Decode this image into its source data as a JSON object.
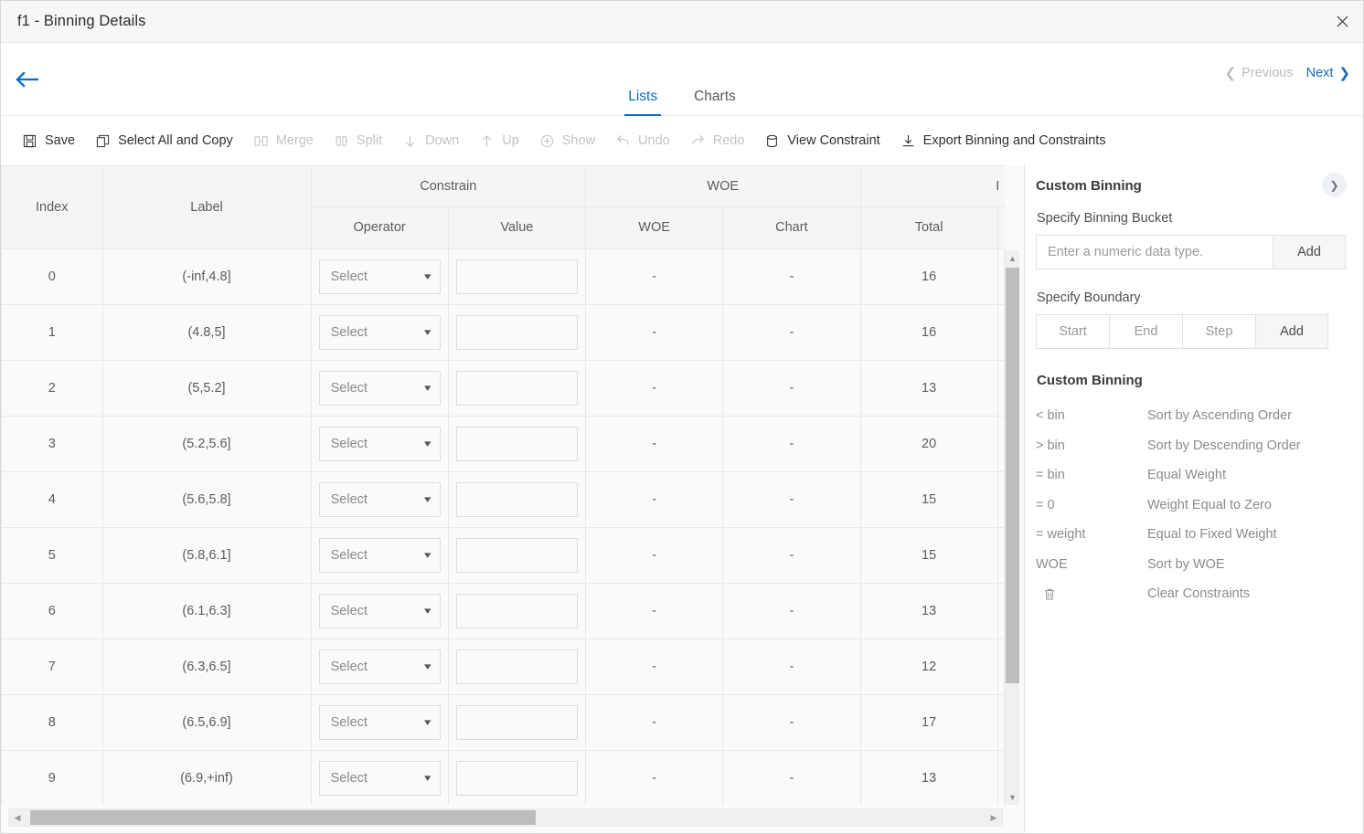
{
  "window": {
    "title": "f1 - Binning Details",
    "close_icon": "close-icon"
  },
  "nav": {
    "back_icon": "back-arrow-icon",
    "tabs": [
      {
        "label": "Lists",
        "active": true
      },
      {
        "label": "Charts",
        "active": false
      }
    ],
    "previous_label": "Previous",
    "next_label": "Next",
    "previous_enabled": false,
    "next_enabled": true,
    "accent_color": "#0f6cbd",
    "disabled_color": "#bdbdbd"
  },
  "toolbar": {
    "items": [
      {
        "label": "Save",
        "icon": "save-icon",
        "enabled": true
      },
      {
        "label": "Select All and Copy",
        "icon": "copy-icon",
        "enabled": true
      },
      {
        "label": "Merge",
        "icon": "merge-icon",
        "enabled": false
      },
      {
        "label": "Split",
        "icon": "split-icon",
        "enabled": false
      },
      {
        "label": "Down",
        "icon": "arrow-down-icon",
        "enabled": false
      },
      {
        "label": "Up",
        "icon": "arrow-up-icon",
        "enabled": false
      },
      {
        "label": "Show",
        "icon": "plus-circle-icon",
        "enabled": false
      },
      {
        "label": "Undo",
        "icon": "undo-icon",
        "enabled": false
      },
      {
        "label": "Redo",
        "icon": "redo-icon",
        "enabled": false
      },
      {
        "label": "View Constraint",
        "icon": "database-icon",
        "enabled": true
      },
      {
        "label": "Export Binning and Constraints",
        "icon": "export-icon",
        "enabled": true
      }
    ]
  },
  "grid": {
    "group_headers": {
      "index": "Index",
      "label": "Label",
      "constrain": "Constrain",
      "woe": "WOE",
      "partial": "I"
    },
    "sub_headers": {
      "operator": "Operator",
      "value": "Value",
      "woe": "WOE",
      "chart": "Chart",
      "total": "Total"
    },
    "operator_placeholder": "Select",
    "value_placeholder": "",
    "empty_mark": "-",
    "rows": [
      {
        "index": "0",
        "label": "(-inf,4.8]",
        "operator": "Select",
        "value": "",
        "woe": "-",
        "chart": "-",
        "total": "16"
      },
      {
        "index": "1",
        "label": "(4.8,5]",
        "operator": "Select",
        "value": "",
        "woe": "-",
        "chart": "-",
        "total": "16"
      },
      {
        "index": "2",
        "label": "(5,5.2]",
        "operator": "Select",
        "value": "",
        "woe": "-",
        "chart": "-",
        "total": "13"
      },
      {
        "index": "3",
        "label": "(5.2,5.6]",
        "operator": "Select",
        "value": "",
        "woe": "-",
        "chart": "-",
        "total": "20"
      },
      {
        "index": "4",
        "label": "(5.6,5.8]",
        "operator": "Select",
        "value": "",
        "woe": "-",
        "chart": "-",
        "total": "15"
      },
      {
        "index": "5",
        "label": "(5.8,6.1]",
        "operator": "Select",
        "value": "",
        "woe": "-",
        "chart": "-",
        "total": "15"
      },
      {
        "index": "6",
        "label": "(6.1,6.3]",
        "operator": "Select",
        "value": "",
        "woe": "-",
        "chart": "-",
        "total": "13"
      },
      {
        "index": "7",
        "label": "(6.3,6.5]",
        "operator": "Select",
        "value": "",
        "woe": "-",
        "chart": "-",
        "total": "12"
      },
      {
        "index": "8",
        "label": "(6.5,6.9]",
        "operator": "Select",
        "value": "",
        "woe": "-",
        "chart": "-",
        "total": "17"
      },
      {
        "index": "9",
        "label": "(6.9,+inf)",
        "operator": "Select",
        "value": "",
        "woe": "-",
        "chart": "-",
        "total": "13"
      }
    ]
  },
  "panel": {
    "heading": "Custom Binning",
    "collapse_icon": "chevron-right-icon",
    "bucket_label": "Specify Binning Bucket",
    "bucket_placeholder": "Enter a numeric data type.",
    "bucket_value": "",
    "bucket_add_label": "Add",
    "boundary_label": "Specify Boundary",
    "boundary_start_placeholder": "Start",
    "boundary_start_value": "",
    "boundary_end_placeholder": "End",
    "boundary_end_value": "",
    "boundary_step_placeholder": "Step",
    "boundary_step_value": "",
    "boundary_add_label": "Add",
    "legend_heading": "Custom Binning",
    "legend": [
      {
        "symbol": "< bin",
        "desc": "Sort by Ascending Order"
      },
      {
        "symbol": "> bin",
        "desc": "Sort by Descending Order"
      },
      {
        "symbol": "= bin",
        "desc": "Equal Weight"
      },
      {
        "symbol": "= 0",
        "desc": "Weight Equal to Zero"
      },
      {
        "symbol": "= weight",
        "desc": "Equal to Fixed Weight"
      },
      {
        "symbol": "WOE",
        "desc": "Sort by WOE"
      },
      {
        "symbol": "",
        "desc": "Clear Constraints",
        "icon": "trash-icon"
      }
    ]
  }
}
